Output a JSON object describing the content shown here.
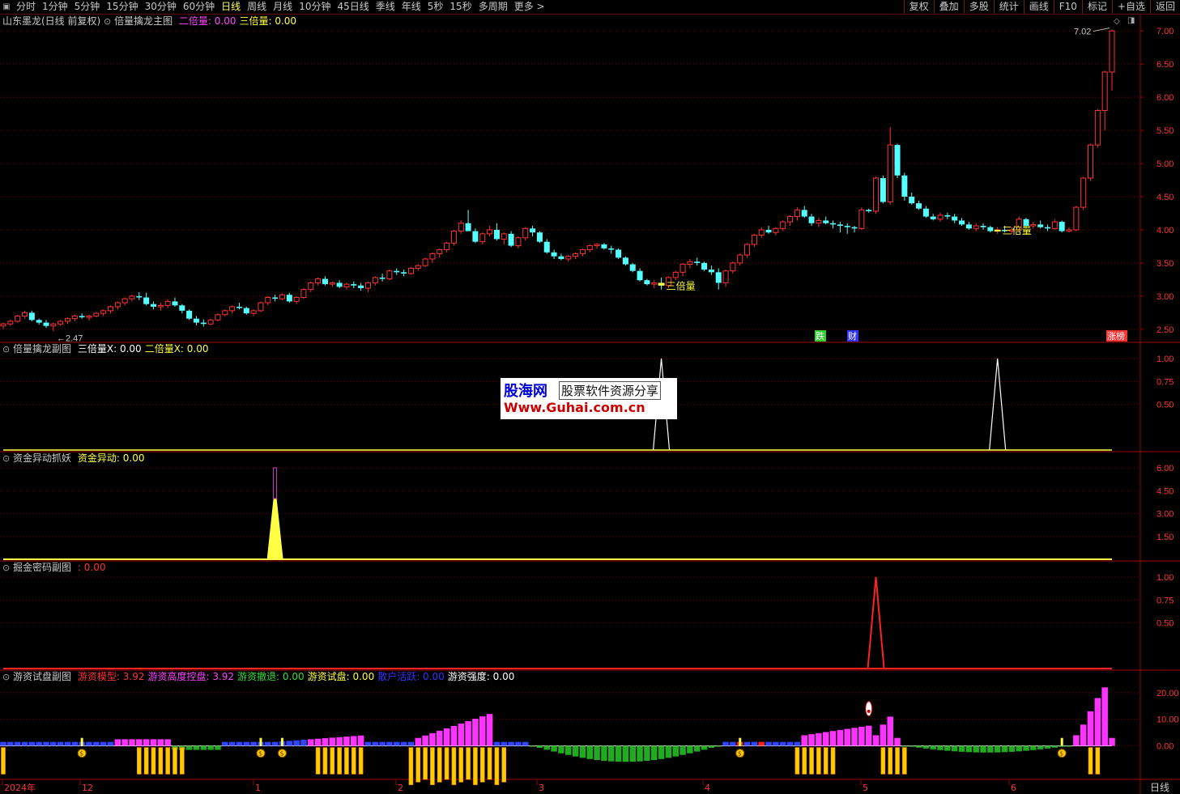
{
  "toolbar": {
    "tabs": [
      "分时",
      "1分钟",
      "5分钟",
      "15分钟",
      "30分钟",
      "60分钟",
      "日线",
      "周线",
      "月线",
      "10分钟",
      "45日线",
      "季线",
      "年线",
      "5秒",
      "15秒",
      "多周期",
      "更多 >"
    ],
    "active_tab": "日线",
    "right_buttons": [
      "复权",
      "叠加",
      "多股",
      "统计",
      "画线",
      "F10",
      "标记",
      "+自选",
      "返回"
    ]
  },
  "main_panel": {
    "stock": "山东墨龙(日线 前复权)",
    "indicator": "倍量擒龙主图",
    "params": [
      {
        "text": "二倍量: 0.00",
        "color": "#ff44ff"
      },
      {
        "text": "三倍量: 0.00",
        "color": "#ffff44"
      }
    ],
    "price_labels": [
      "7.00",
      "6.50",
      "6.00",
      "5.50",
      "5.00",
      "4.50",
      "4.00",
      "3.50",
      "3.00",
      "2.50"
    ],
    "high_label": "7.02",
    "low_label": "2.47",
    "triple_marks": [
      "三倍量",
      "三倍量"
    ],
    "event_tags": [
      "跌",
      "财",
      "涨榜"
    ]
  },
  "sub1": {
    "name": "倍量擒龙副图",
    "params": [
      {
        "text": "三倍量X: 0.00",
        "color": "#ffffff"
      },
      {
        "text": "二倍量X: 0.00",
        "color": "#ffff44"
      }
    ],
    "axis": [
      "1.00",
      "0.75",
      "0.50"
    ]
  },
  "sub2": {
    "name": "资金异动抓妖",
    "params": [
      {
        "text": "资金异动: 0.00",
        "color": "#ffff44"
      }
    ],
    "axis": [
      "6.00",
      "4.50",
      "3.00",
      "1.50"
    ]
  },
  "sub3": {
    "name": "掘金密码副图",
    "params": [
      {
        "text": ": 0.00",
        "color": "#ff3333"
      }
    ],
    "axis": [
      "1.00",
      "0.75",
      "0.50"
    ]
  },
  "sub4": {
    "name": "游资试盘副图",
    "params": [
      {
        "text": "游资模型: 3.92",
        "color": "#ff3333"
      },
      {
        "text": "游资高度控盘: 3.92",
        "color": "#ff44ff"
      },
      {
        "text": "游资撤退: 0.00",
        "color": "#33dd33"
      },
      {
        "text": "游资试盘: 0.00",
        "color": "#ffff44"
      },
      {
        "text": "散户活跃: 0.00",
        "color": "#3333ff"
      },
      {
        "text": "游资强度: 0.00",
        "color": "#ffffff"
      }
    ],
    "axis": [
      "20.00",
      "10.00",
      "0.00"
    ]
  },
  "watermark": {
    "brand": "股海网",
    "slogan": "股票软件资源分享",
    "url": "Www.Guhai.com.cn"
  },
  "date_axis": {
    "labels": [
      "2024年",
      "12",
      "1",
      "2",
      "3",
      "4",
      "5",
      "6"
    ],
    "period": "日线"
  },
  "colors": {
    "up": "#ff3333",
    "down": "#54ffff",
    "grid": "#7a0000",
    "axis_text": "#ff3333"
  },
  "chart_data": {
    "type": "candlestick",
    "period": "daily",
    "y_range": [
      2.4,
      7.1
    ],
    "candles_ohlc": [
      [
        2.55,
        2.6,
        2.5,
        2.58
      ],
      [
        2.58,
        2.65,
        2.55,
        2.62
      ],
      [
        2.62,
        2.72,
        2.6,
        2.7
      ],
      [
        2.7,
        2.78,
        2.66,
        2.75
      ],
      [
        2.75,
        2.78,
        2.62,
        2.64
      ],
      [
        2.64,
        2.66,
        2.57,
        2.6
      ],
      [
        2.6,
        2.64,
        2.52,
        2.55
      ],
      [
        2.55,
        2.6,
        2.47,
        2.58
      ],
      [
        2.58,
        2.64,
        2.55,
        2.62
      ],
      [
        2.62,
        2.68,
        2.58,
        2.66
      ],
      [
        2.66,
        2.72,
        2.62,
        2.7
      ],
      [
        2.7,
        2.74,
        2.66,
        2.68
      ],
      [
        2.68,
        2.72,
        2.63,
        2.7
      ],
      [
        2.7,
        2.76,
        2.68,
        2.74
      ],
      [
        2.74,
        2.8,
        2.7,
        2.78
      ],
      [
        2.78,
        2.86,
        2.74,
        2.84
      ],
      [
        2.84,
        2.92,
        2.8,
        2.9
      ],
      [
        2.9,
        2.98,
        2.86,
        2.96
      ],
      [
        2.96,
        3.02,
        2.92,
        3.0
      ],
      [
        3.0,
        3.06,
        2.94,
        2.98
      ],
      [
        2.98,
        3.05,
        2.86,
        2.88
      ],
      [
        2.88,
        2.92,
        2.8,
        2.84
      ],
      [
        2.84,
        2.9,
        2.78,
        2.86
      ],
      [
        2.86,
        2.95,
        2.82,
        2.92
      ],
      [
        2.92,
        2.98,
        2.84,
        2.86
      ],
      [
        2.86,
        2.88,
        2.74,
        2.78
      ],
      [
        2.78,
        2.8,
        2.64,
        2.66
      ],
      [
        2.66,
        2.7,
        2.56,
        2.6
      ],
      [
        2.6,
        2.65,
        2.54,
        2.58
      ],
      [
        2.58,
        2.66,
        2.56,
        2.64
      ],
      [
        2.64,
        2.74,
        2.62,
        2.72
      ],
      [
        2.72,
        2.8,
        2.7,
        2.78
      ],
      [
        2.78,
        2.86,
        2.74,
        2.84
      ],
      [
        2.84,
        2.9,
        2.8,
        2.82
      ],
      [
        2.82,
        2.84,
        2.72,
        2.74
      ],
      [
        2.74,
        2.8,
        2.7,
        2.78
      ],
      [
        2.78,
        2.92,
        2.76,
        2.9
      ],
      [
        2.9,
        3.0,
        2.86,
        2.98
      ],
      [
        2.98,
        3.02,
        2.92,
        2.96
      ],
      [
        2.96,
        3.04,
        2.94,
        3.02
      ],
      [
        3.02,
        3.05,
        2.9,
        2.92
      ],
      [
        2.92,
        3.0,
        2.88,
        2.98
      ],
      [
        2.98,
        3.12,
        2.96,
        3.1
      ],
      [
        3.1,
        3.22,
        3.06,
        3.2
      ],
      [
        3.2,
        3.28,
        3.16,
        3.26
      ],
      [
        3.26,
        3.3,
        3.16,
        3.18
      ],
      [
        3.18,
        3.22,
        3.14,
        3.2
      ],
      [
        3.2,
        3.24,
        3.12,
        3.14
      ],
      [
        3.14,
        3.2,
        3.1,
        3.18
      ],
      [
        3.18,
        3.22,
        3.12,
        3.16
      ],
      [
        3.16,
        3.2,
        3.08,
        3.12
      ],
      [
        3.12,
        3.22,
        3.06,
        3.2
      ],
      [
        3.2,
        3.3,
        3.16,
        3.28
      ],
      [
        3.28,
        3.34,
        3.22,
        3.26
      ],
      [
        3.26,
        3.4,
        3.24,
        3.38
      ],
      [
        3.38,
        3.42,
        3.32,
        3.36
      ],
      [
        3.36,
        3.4,
        3.3,
        3.34
      ],
      [
        3.34,
        3.44,
        3.32,
        3.42
      ],
      [
        3.42,
        3.48,
        3.38,
        3.46
      ],
      [
        3.46,
        3.58,
        3.44,
        3.56
      ],
      [
        3.56,
        3.66,
        3.5,
        3.64
      ],
      [
        3.64,
        3.72,
        3.58,
        3.7
      ],
      [
        3.7,
        3.82,
        3.66,
        3.8
      ],
      [
        3.8,
        4.0,
        3.76,
        3.98
      ],
      [
        3.98,
        4.14,
        3.94,
        4.1
      ],
      [
        4.1,
        4.3,
        3.98,
        3.98
      ],
      [
        3.98,
        4.02,
        3.8,
        3.82
      ],
      [
        3.82,
        3.96,
        3.78,
        3.94
      ],
      [
        3.94,
        4.06,
        3.9,
        4.0
      ],
      [
        4.0,
        4.1,
        3.84,
        3.86
      ],
      [
        3.86,
        3.96,
        3.78,
        3.94
      ],
      [
        3.94,
        3.98,
        3.74,
        3.76
      ],
      [
        3.76,
        3.9,
        3.72,
        3.88
      ],
      [
        3.88,
        4.04,
        3.84,
        4.02
      ],
      [
        4.02,
        4.06,
        3.9,
        3.96
      ],
      [
        3.96,
        3.98,
        3.8,
        3.82
      ],
      [
        3.82,
        3.86,
        3.64,
        3.66
      ],
      [
        3.66,
        3.7,
        3.56,
        3.6
      ],
      [
        3.6,
        3.64,
        3.54,
        3.56
      ],
      [
        3.56,
        3.62,
        3.52,
        3.6
      ],
      [
        3.6,
        3.66,
        3.56,
        3.64
      ],
      [
        3.64,
        3.72,
        3.6,
        3.7
      ],
      [
        3.7,
        3.78,
        3.66,
        3.76
      ],
      [
        3.76,
        3.8,
        3.72,
        3.78
      ],
      [
        3.78,
        3.8,
        3.7,
        3.72
      ],
      [
        3.72,
        3.76,
        3.64,
        3.7
      ],
      [
        3.7,
        3.72,
        3.56,
        3.58
      ],
      [
        3.58,
        3.6,
        3.46,
        3.48
      ],
      [
        3.48,
        3.5,
        3.36,
        3.38
      ],
      [
        3.38,
        3.42,
        3.22,
        3.24
      ],
      [
        3.24,
        3.26,
        3.16,
        3.18
      ],
      [
        3.18,
        3.24,
        3.12,
        3.2
      ],
      [
        3.2,
        3.28,
        3.1,
        3.16
      ],
      [
        3.16,
        3.3,
        3.12,
        3.28
      ],
      [
        3.28,
        3.38,
        3.24,
        3.36
      ],
      [
        3.36,
        3.5,
        3.3,
        3.48
      ],
      [
        3.48,
        3.56,
        3.42,
        3.52
      ],
      [
        3.52,
        3.58,
        3.46,
        3.5
      ],
      [
        3.5,
        3.52,
        3.38,
        3.4
      ],
      [
        3.4,
        3.46,
        3.32,
        3.36
      ],
      [
        3.36,
        3.42,
        3.1,
        3.2
      ],
      [
        3.2,
        3.4,
        3.14,
        3.38
      ],
      [
        3.38,
        3.52,
        3.34,
        3.5
      ],
      [
        3.5,
        3.64,
        3.46,
        3.62
      ],
      [
        3.62,
        3.8,
        3.58,
        3.78
      ],
      [
        3.78,
        3.94,
        3.74,
        3.92
      ],
      [
        3.92,
        4.04,
        3.88,
        4.0
      ],
      [
        4.0,
        4.06,
        3.94,
        3.96
      ],
      [
        3.96,
        4.04,
        3.92,
        4.02
      ],
      [
        4.02,
        4.14,
        3.98,
        4.12
      ],
      [
        4.12,
        4.22,
        4.06,
        4.2
      ],
      [
        4.2,
        4.34,
        4.14,
        4.3
      ],
      [
        4.3,
        4.36,
        4.18,
        4.2
      ],
      [
        4.2,
        4.24,
        4.06,
        4.1
      ],
      [
        4.1,
        4.18,
        4.04,
        4.14
      ],
      [
        4.14,
        4.2,
        4.08,
        4.1
      ],
      [
        4.1,
        4.14,
        4.02,
        4.08
      ],
      [
        4.08,
        4.12,
        3.96,
        4.06
      ],
      [
        4.06,
        4.1,
        3.94,
        4.04
      ],
      [
        4.04,
        4.06,
        3.96,
        4.02
      ],
      [
        4.02,
        4.34,
        4.0,
        4.3
      ],
      [
        4.3,
        4.32,
        4.26,
        4.28
      ],
      [
        4.28,
        4.8,
        4.24,
        4.78
      ],
      [
        4.78,
        4.82,
        4.4,
        4.42
      ],
      [
        4.42,
        5.55,
        4.38,
        5.28
      ],
      [
        5.28,
        5.3,
        4.78,
        4.82
      ],
      [
        4.82,
        4.86,
        4.44,
        4.5
      ],
      [
        4.5,
        4.56,
        4.38,
        4.4
      ],
      [
        4.4,
        4.44,
        4.3,
        4.32
      ],
      [
        4.32,
        4.36,
        4.18,
        4.2
      ],
      [
        4.2,
        4.24,
        4.14,
        4.16
      ],
      [
        4.16,
        4.26,
        4.12,
        4.22
      ],
      [
        4.22,
        4.26,
        4.16,
        4.2
      ],
      [
        4.2,
        4.24,
        4.1,
        4.14
      ],
      [
        4.14,
        4.18,
        4.06,
        4.08
      ],
      [
        4.08,
        4.12,
        4.0,
        4.02
      ],
      [
        4.02,
        4.1,
        3.98,
        4.06
      ],
      [
        4.06,
        4.1,
        4.0,
        4.04
      ],
      [
        4.04,
        4.06,
        3.96,
        3.98
      ],
      [
        3.98,
        4.04,
        3.94,
        4.0
      ],
      [
        4.0,
        4.06,
        3.96,
        3.98
      ],
      [
        3.98,
        4.04,
        3.94,
        4.0
      ],
      [
        4.0,
        4.2,
        3.96,
        4.16
      ],
      [
        4.16,
        4.18,
        4.02,
        4.06
      ],
      [
        4.06,
        4.12,
        4.02,
        4.08
      ],
      [
        4.08,
        4.14,
        4.02,
        4.04
      ],
      [
        4.04,
        4.08,
        3.98,
        4.02
      ],
      [
        4.02,
        4.16,
        4.0,
        4.12
      ],
      [
        4.12,
        4.14,
        3.96,
        3.98
      ],
      [
        3.98,
        4.04,
        3.96,
        4.0
      ],
      [
        4.0,
        4.36,
        3.98,
        4.34
      ],
      [
        4.34,
        4.8,
        4.3,
        4.78
      ],
      [
        4.78,
        5.3,
        4.74,
        5.28
      ],
      [
        5.28,
        5.82,
        5.24,
        5.8
      ],
      [
        5.8,
        6.4,
        5.5,
        6.38
      ],
      [
        6.38,
        7.02,
        6.1,
        7.0
      ]
    ],
    "sub1_spikes": [
      {
        "bar": 92,
        "value": 1.0
      },
      {
        "bar": 139,
        "value": 1.0
      }
    ],
    "sub2_spike": {
      "bar": 38,
      "value": 6.0
    },
    "sub3_spike": {
      "bar": 122,
      "value": 1.0
    },
    "sub4_y_range": [
      -12,
      23
    ]
  }
}
